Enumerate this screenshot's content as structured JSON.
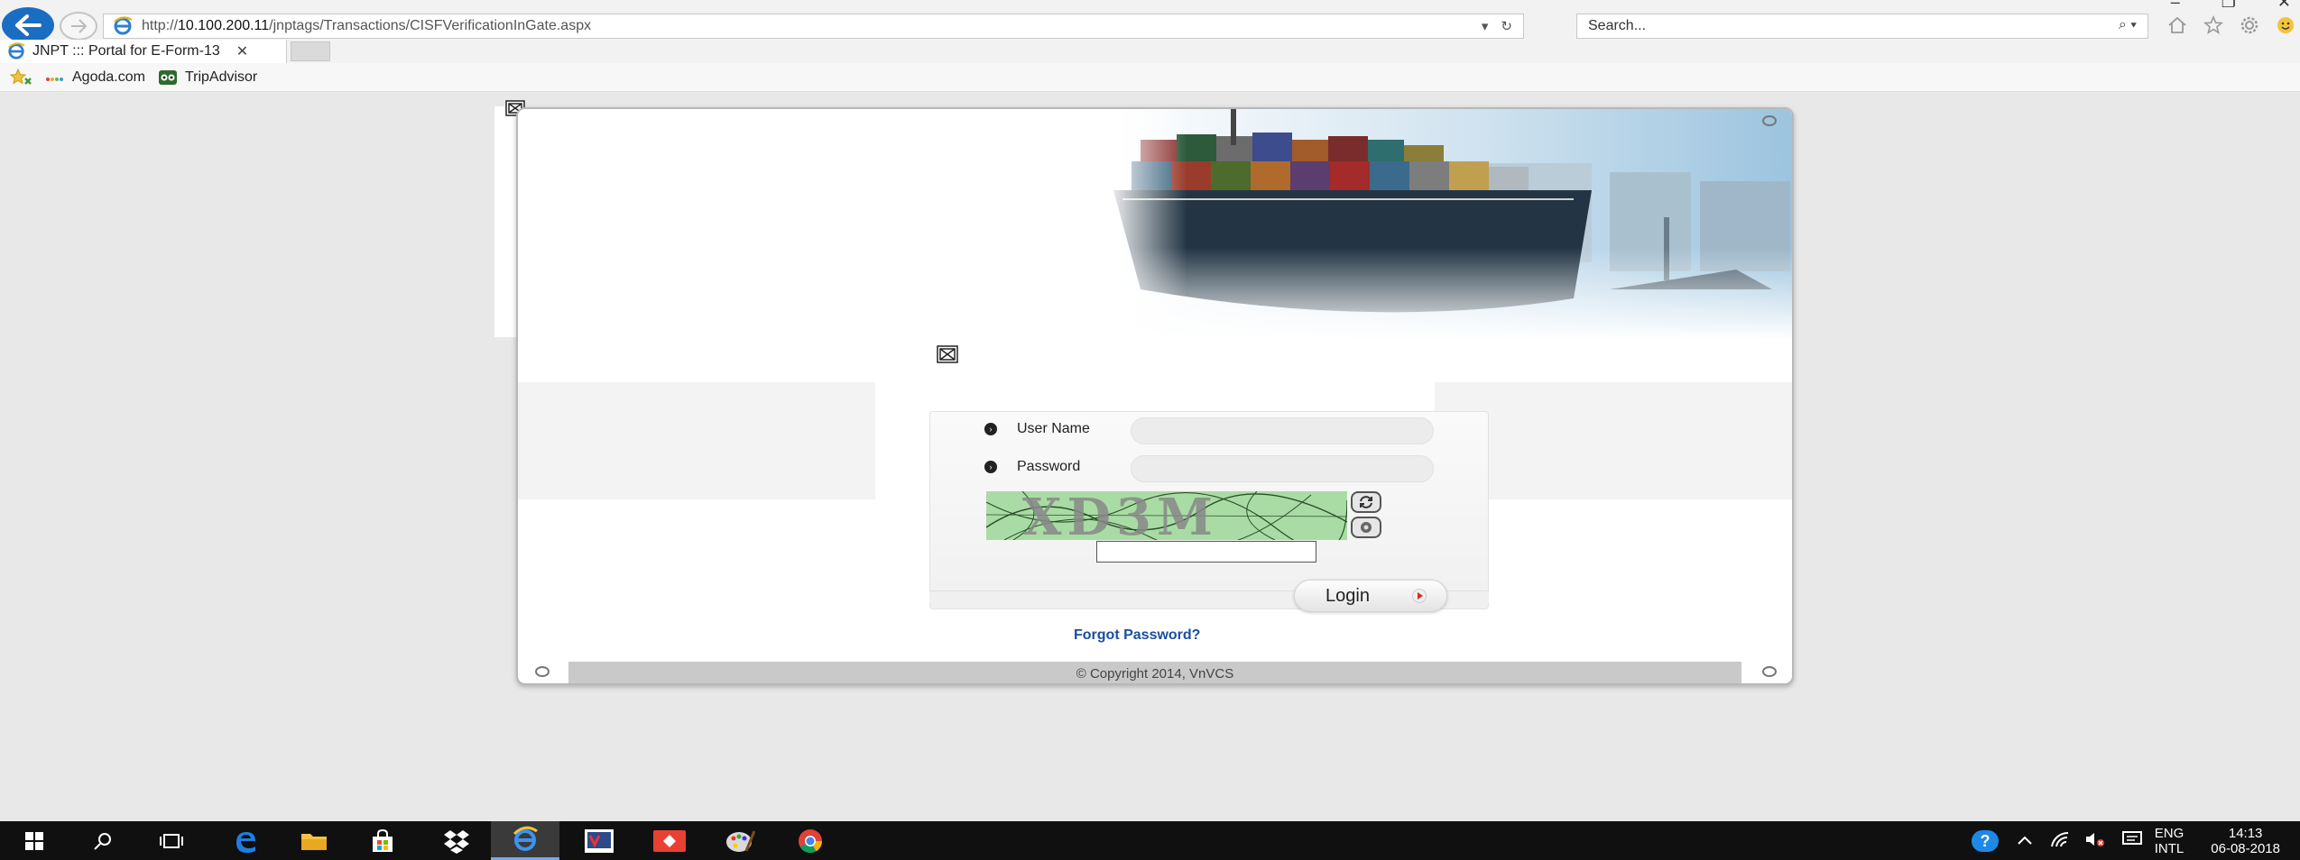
{
  "browser": {
    "url_prefix": "http://",
    "url_host": "10.100.200.11",
    "url_path": "/jnptags/Transactions/CISFVerificationInGate.aspx",
    "search_placeholder": "Search...",
    "tab_title": "JNPT ::: Portal for E-Form-13",
    "tab_close": "✕",
    "favorites": [
      {
        "label": "Agoda.com",
        "icon": "agoda-icon"
      },
      {
        "label": "TripAdvisor",
        "icon": "tripadvisor-icon"
      }
    ]
  },
  "login": {
    "username_label": "User Name",
    "password_label": "Password",
    "username_value": "",
    "password_value": "",
    "captcha_text": "XD3M",
    "captcha_input_value": "",
    "login_label": "Login",
    "forgot_label": "Forgot Password?",
    "copyright": "© Copyright 2014, VnVCS"
  },
  "taskbar": {
    "lang_top": "ENG",
    "lang_bottom": "INTL",
    "time": "14:13",
    "date": "06-08-2018"
  },
  "colors": {
    "accent_blue": "#1a6ec2",
    "link_blue": "#1a4fa0",
    "captcha_green": "#a9dca4",
    "login_arrow_red": "#d42a1f"
  }
}
